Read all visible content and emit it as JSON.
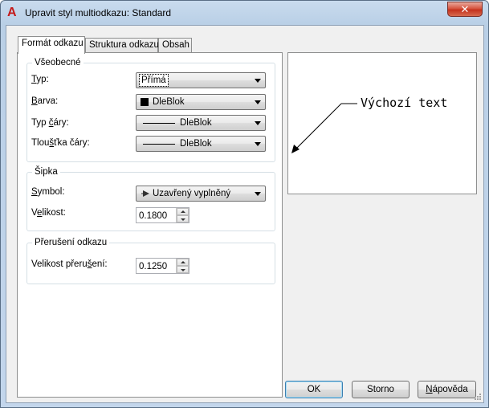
{
  "window": {
    "app_icon": "A",
    "title": "Upravit styl multiodkazu: Standard",
    "close_glyph": "✕"
  },
  "tabs": [
    {
      "label": "Formát odkazu",
      "active": true
    },
    {
      "label": "Struktura odkazu",
      "active": false
    },
    {
      "label": "Obsah",
      "active": false
    }
  ],
  "general": {
    "title": "Všeobecné",
    "type": {
      "label_u": "T",
      "label_rest": "yp:",
      "value": "Přímá"
    },
    "color": {
      "label_u": "B",
      "label_rest": "arva:",
      "value": "DleBlok",
      "swatch": "#000000"
    },
    "linetype": {
      "label_pre": "Typ ",
      "label_u": "č",
      "label_rest": "áry:",
      "value": "DleBlok"
    },
    "lineweight": {
      "label_pre": "Tlou",
      "label_u": "š",
      "label_rest": "ťka čáry:",
      "value": "DleBlok"
    }
  },
  "arrow": {
    "title": "Šipka",
    "symbol": {
      "label_u": "S",
      "label_rest": "ymbol:",
      "value": "Uzavřený vyplněný"
    },
    "size": {
      "label_pre": "V",
      "label_u": "e",
      "label_rest": "likost:",
      "value": "0.1800"
    }
  },
  "landing_break": {
    "title": "Přerušení odkazu",
    "break_size": {
      "label_pre": "Velikost přeru",
      "label_u": "š",
      "label_rest": "ení:",
      "value": "0.1250"
    }
  },
  "preview": {
    "text": "Výchozí text"
  },
  "buttons": {
    "ok": "OK",
    "cancel": "Storno",
    "help_u": "N",
    "help_rest": "ápověda"
  }
}
